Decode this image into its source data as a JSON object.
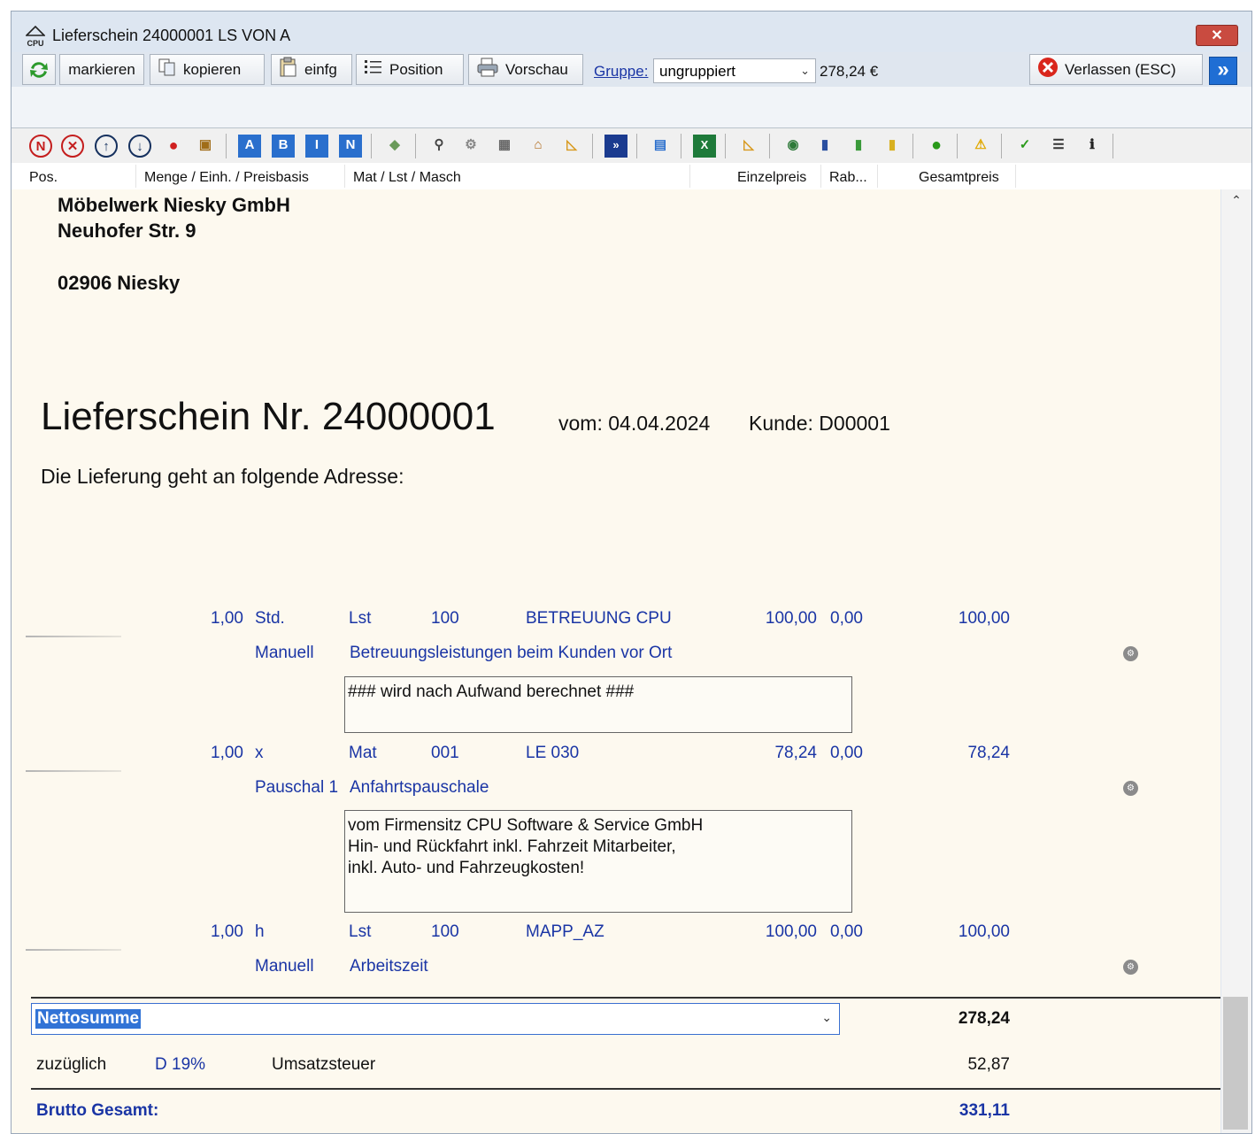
{
  "window": {
    "title": "Lieferschein 24000001 LS VON A",
    "app_icon_text": "CPU",
    "close_label": "✕"
  },
  "toolbar": {
    "refresh_icon": "refresh-icon",
    "markieren": "markieren",
    "kopieren": "kopieren",
    "einfg": "einfg",
    "position": "Position",
    "vorschau": "Vorschau",
    "gruppe_label": "Gruppe:",
    "gruppe_value": "ungruppiert",
    "total": "278,24 €",
    "verlassen": "Verlassen (ESC)",
    "forward_icon": "»"
  },
  "iconbar": {
    "letters": [
      "A",
      "B",
      "I",
      "N"
    ]
  },
  "columns": {
    "pos": "Pos.",
    "menge": "Menge / Einh. / Preisbasis",
    "mat": "Mat / Lst / Masch",
    "einzelpreis": "Einzelpreis",
    "rab": "Rab...",
    "gesamtpreis": "Gesamtpreis"
  },
  "address": {
    "company": "Möbelwerk Niesky GmbH",
    "street": "Neuhofer Str. 9",
    "city": "02906 Niesky"
  },
  "document": {
    "heading": "Lieferschein Nr. 24000001",
    "date": "vom: 04.04.2024",
    "customer": "Kunde: D00001",
    "intro": "Die Lieferung geht an folgende Adresse:"
  },
  "positions": [
    {
      "menge": "1,00",
      "einheit": "Std.",
      "art": "Lst",
      "nr": "100",
      "artikel": "BETREUUNG CPU",
      "einzelpreis": "100,00",
      "rabatt": "0,00",
      "gesamt": "100,00",
      "preisbasis": "Manuell",
      "bezeichnung": "Betreuungsleistungen beim Kunden vor Ort",
      "text_lines": [
        "### wird nach Aufwand berechnet ###"
      ]
    },
    {
      "menge": "1,00",
      "einheit": "x",
      "art": "Mat",
      "nr": "001",
      "artikel": "LE 030",
      "einzelpreis": "78,24",
      "rabatt": "0,00",
      "gesamt": "78,24",
      "preisbasis": "Pauschal 1",
      "bezeichnung": "Anfahrtspauschale",
      "text_lines": [
        "vom Firmensitz CPU Software & Service GmbH",
        "Hin- und Rückfahrt inkl. Fahrzeit Mitarbeiter,",
        "inkl. Auto- und Fahrzeugkosten!"
      ]
    },
    {
      "menge": "1,00",
      "einheit": "h",
      "art": "Lst",
      "nr": "100",
      "artikel": "MAPP_AZ",
      "einzelpreis": "100,00",
      "rabatt": "0,00",
      "gesamt": "100,00",
      "preisbasis": "Manuell",
      "bezeichnung": "Arbeitszeit"
    }
  ],
  "totals": {
    "netto_label": "Nettosumme",
    "netto_value": "278,24",
    "zuzueglich": "zuzüglich",
    "tax_code": "D 19%",
    "tax_label": "Umsatzsteuer",
    "tax_value": "52,87",
    "brutto_label": "Brutto Gesamt:",
    "brutto_value": "331,11"
  },
  "colors": {
    "paper": "#fdf9ef",
    "blue_text": "#1a35a5",
    "window_bg": "#dfe6ef"
  }
}
